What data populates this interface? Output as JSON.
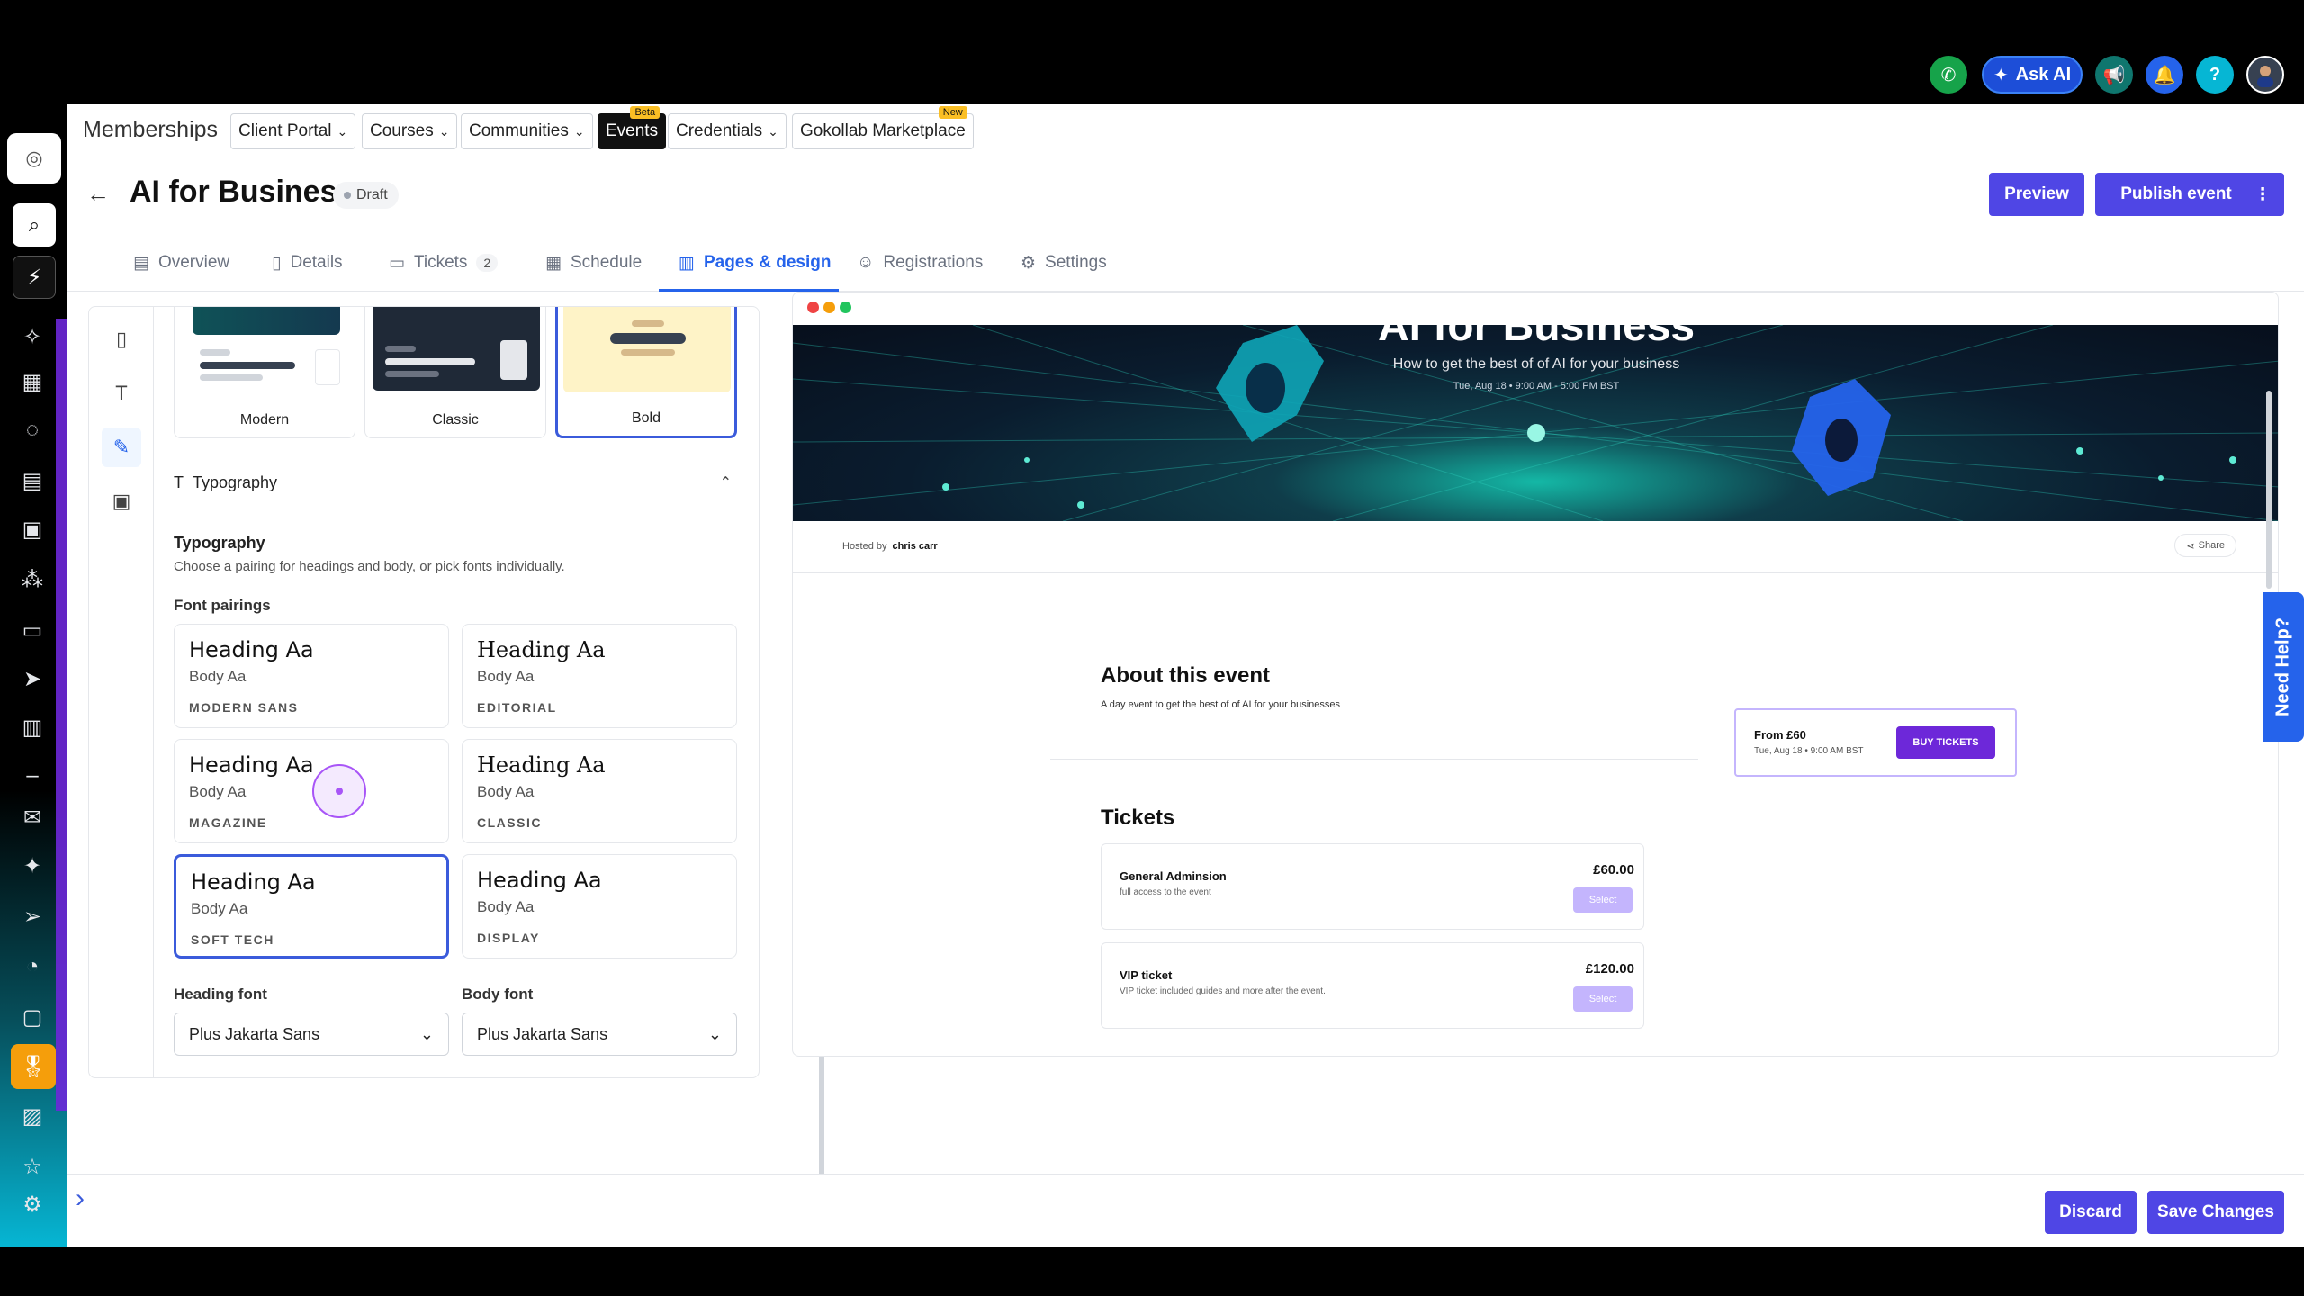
{
  "topbar": {
    "ask_ai_label": "Ask AI",
    "icons": [
      "phone-icon",
      "sparkle-icon",
      "megaphone-icon",
      "bell-icon",
      "help-icon",
      "avatar"
    ],
    "colors": {
      "phone": "#16a34a",
      "ask_ai": "#1d4ed8",
      "megaphone": "#0f766e",
      "bell": "#2563eb",
      "help": "#06b6d4"
    }
  },
  "nav": {
    "title": "Memberships",
    "items": [
      {
        "label": "Client Portal",
        "dropdown": true
      },
      {
        "label": "Courses",
        "dropdown": true
      },
      {
        "label": "Communities",
        "dropdown": true
      },
      {
        "label": "Events",
        "badge": "Beta",
        "active": true
      },
      {
        "label": "Credentials",
        "dropdown": true
      },
      {
        "label": "Gokollab Marketplace",
        "badge": "New"
      }
    ]
  },
  "header": {
    "title": "AI for Business",
    "status": "Draft",
    "preview_label": "Preview",
    "publish_label": "Publish event",
    "more_label": "⋮"
  },
  "tabs": [
    {
      "label": "Overview",
      "icon": "overview-icon"
    },
    {
      "label": "Details",
      "icon": "document-icon"
    },
    {
      "label": "Tickets",
      "icon": "ticket-icon",
      "count": "2"
    },
    {
      "label": "Schedule",
      "icon": "calendar-icon"
    },
    {
      "label": "Pages & design",
      "icon": "layout-icon",
      "active": true
    },
    {
      "label": "Registrations",
      "icon": "users-icon"
    },
    {
      "label": "Settings",
      "icon": "gear-icon"
    }
  ],
  "themes": [
    {
      "name": "Modern"
    },
    {
      "name": "Classic"
    },
    {
      "name": "Bold",
      "selected": true
    }
  ],
  "typography": {
    "section_label": "Typography",
    "title": "Typography",
    "description": "Choose a pairing for headings and body, or pick fonts individually.",
    "pairings_label": "Font pairings",
    "pairings": [
      {
        "heading": "Heading Aa",
        "body": "Body Aa",
        "name": "MODERN SANS"
      },
      {
        "heading": "Heading Aa",
        "body": "Body Aa",
        "name": "EDITORIAL"
      },
      {
        "heading": "Heading Aa",
        "body": "Body Aa",
        "name": "MAGAZINE"
      },
      {
        "heading": "Heading Aa",
        "body": "Body Aa",
        "name": "CLASSIC"
      },
      {
        "heading": "Heading Aa",
        "body": "Body Aa",
        "name": "SOFT TECH",
        "selected": true
      },
      {
        "heading": "Heading Aa",
        "body": "Body Aa",
        "name": "DISPLAY"
      }
    ],
    "heading_font_label": "Heading font",
    "heading_font_value": "Plus Jakarta Sans",
    "body_font_label": "Body font",
    "body_font_value": "Plus Jakarta Sans"
  },
  "preview": {
    "hero_title": "AI for Business",
    "hero_subtitle": "How to get the best of of AI for your business",
    "hero_date": "Tue, Aug 18 • 9:00 AM - 5:00 PM BST",
    "hosted_by_label": "Hosted by",
    "host_name": "chris carr",
    "share_label": "Share",
    "about_title": "About this event",
    "about_text": "A day event to get the best of of AI for your businesses",
    "buy_from": "From £60",
    "buy_date": "Tue, Aug 18 • 9:00 AM BST",
    "buy_label": "BUY TICKETS",
    "tickets_title": "Tickets",
    "tickets": [
      {
        "name": "General Adminsion",
        "desc": "full access to the event",
        "price": "£60.00",
        "select": "Select"
      },
      {
        "name": "VIP ticket",
        "desc": "VIP ticket included guides and more after the event.",
        "price": "£120.00",
        "select": "Select"
      }
    ]
  },
  "need_help_label": "Need Help?",
  "footer": {
    "discard_label": "Discard",
    "save_label": "Save Changes"
  }
}
